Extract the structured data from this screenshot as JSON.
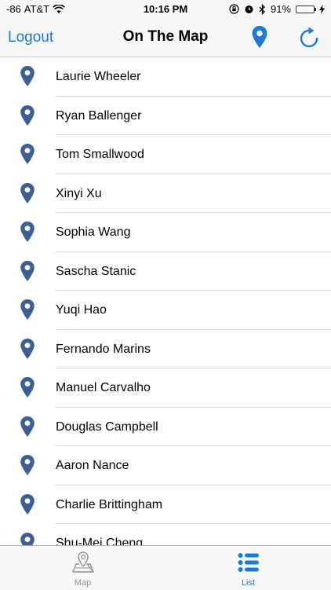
{
  "status": {
    "signal": "-86",
    "carrier": "AT&T",
    "time": "10:16 PM",
    "battery": "91%",
    "battery_level": 0.91
  },
  "nav": {
    "left_label": "Logout",
    "title": "On The Map"
  },
  "colors": {
    "accent": "#1a7bd8",
    "pin": "#3e5f93",
    "tab_inactive": "#929292"
  },
  "students": [
    "Laurie Wheeler",
    "Ryan Ballenger",
    "Tom Smallwood",
    "Xinyi Xu",
    "Sophia Wang",
    "Sascha Stanic",
    "Yuqi Hao",
    "Fernando Marins",
    "Manuel Carvalho",
    "Douglas Campbell",
    "Aaron Nance",
    "Charlie Brittingham",
    "Shu-Mei Cheng"
  ],
  "tabs": [
    {
      "label": "Map",
      "icon": "map-icon",
      "selected": false
    },
    {
      "label": "List",
      "icon": "list-icon",
      "selected": true
    }
  ]
}
